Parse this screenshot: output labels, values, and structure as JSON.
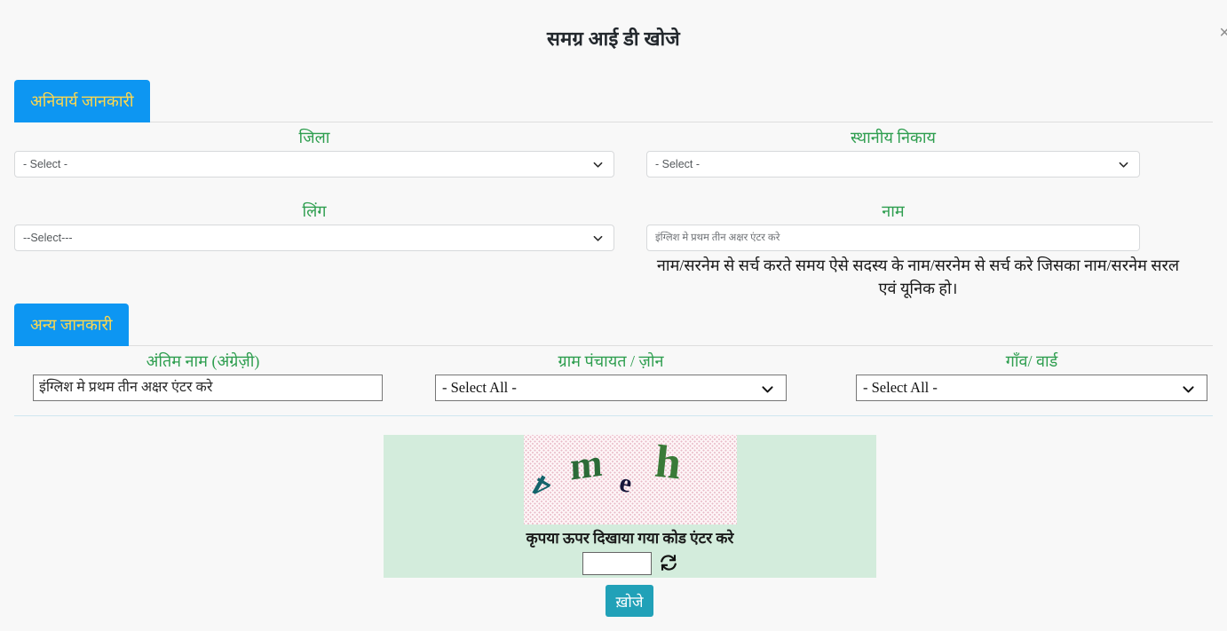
{
  "header": {
    "title": "समग्र आई डी खोजे",
    "close_icon": "close-icon",
    "close_label": "×"
  },
  "sections": [
    {
      "tab_label": "अनिवार्य जानकारी",
      "fields": [
        {
          "label": "जिला",
          "type": "select",
          "value": "- Select -"
        },
        {
          "label": "स्थानीय निकाय",
          "type": "select",
          "value": "- Select -"
        },
        {
          "label": "लिंग",
          "type": "select",
          "value": "--Select---"
        },
        {
          "label": "नाम",
          "type": "text",
          "value": "",
          "placeholder": "इंग्लिश मे प्रथम तीन अक्षर एंटर करे"
        }
      ],
      "help_text": "नाम/सरनेम से सर्च करते समय ऐसे सदस्य के नाम/सरनेम से सर्च करे जिसका नाम/सरनेम सरल एवं यूनिक हो।"
    },
    {
      "tab_label": "अन्य जानकारी",
      "fields": [
        {
          "label": "अंतिम नाम (अंग्रेज़ी)",
          "type": "text",
          "value": "",
          "placeholder": "इंग्लिश मे प्रथम तीन अक्षर एंटर करे"
        },
        {
          "label": "ग्राम पंचायत / ज़ोन",
          "type": "select",
          "value": "- Select All -"
        },
        {
          "label": "गाँव/ वार्ड",
          "type": "select",
          "value": "- Select All -"
        }
      ]
    }
  ],
  "captcha": {
    "characters": [
      "4",
      "m",
      "e",
      "h"
    ],
    "prompt": "कृपया ऊपर दिखाया गया कोड एंटर करे",
    "input_value": "",
    "refresh_icon": "refresh-icon"
  },
  "actions": {
    "search_label": "ख़ोजे"
  },
  "colors": {
    "tab_background": "#0d96f2",
    "tab_text": "#ffd84d",
    "label_green": "#2e9e4f",
    "captcha_panel": "#d3ecdc",
    "search_button": "#21a1b8",
    "page_background": "#f8f8f8",
    "divider": "#cfe6f0"
  }
}
